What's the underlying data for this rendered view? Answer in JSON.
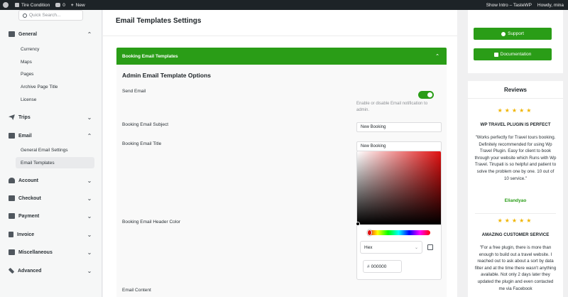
{
  "adminbar": {
    "site": "Tire Condition",
    "comments": "0",
    "new_label": "New",
    "show_intro": "Show Intro – TasteWP",
    "howdy": "Howdy, mina"
  },
  "sidebar": {
    "search_placeholder": "Quick Search...",
    "sections": [
      {
        "label": "General"
      },
      {
        "label": "Trips"
      },
      {
        "label": "Email"
      },
      {
        "label": "Account"
      },
      {
        "label": "Checkout"
      },
      {
        "label": "Payment"
      },
      {
        "label": "Invoice"
      },
      {
        "label": "Miscellaneous"
      },
      {
        "label": "Advanced"
      }
    ],
    "general_items": [
      "Currency",
      "Maps",
      "Pages",
      "Archive Page Title",
      "License"
    ],
    "email_items": [
      "General Email Settings",
      "Email Templates"
    ]
  },
  "main": {
    "title": "Email Templates Settings",
    "accordion_label": "Booking Email Templates",
    "section_title": "Admin Email Template Options",
    "send_email_label": "Send Email",
    "send_email_hint": "Enable or disable Email notification to admin.",
    "subject_label": "Booking Email Subject",
    "subject_value": "New Booking",
    "email_title_label": "Booking Email Title",
    "email_title_value": "New Booking",
    "header_color_label": "Booking Email Header Color",
    "color_format": "Hex",
    "color_hash": "#",
    "color_value": "000000",
    "content_label": "Email Content",
    "send_email_enabled": true
  },
  "right": {
    "support_label": "Support",
    "documentation_label": "Documentation",
    "reviews_heading": "Reviews",
    "stars": "★★★★★",
    "reviews": [
      {
        "title": "WP TRAVEL PLUGIN IS PERFECT",
        "text": "\"Works perfectly for Travel tours booking. Definitely recommended for using Wp Travel Plugin. Easy for client to book through your website which Runs with Wp Travel. Tirupati is so helpful and patient to solve the problem one by one. 10 out of 10 service.\"",
        "author": "Eliandyao"
      },
      {
        "title": "AMAZING CUSTOMER SERVICE",
        "text": "\"For a free plugin, there is more than enough to build out a travel website. I reached out to ask about a sort by data filter and at the time there wasn't anything available. Not only 2 days later they updated the plugin and even contacted me via Facebook"
      }
    ]
  },
  "colors": {
    "accent": "#2a9d17",
    "star": "#f0b400",
    "adminbar": "#1d2327"
  }
}
